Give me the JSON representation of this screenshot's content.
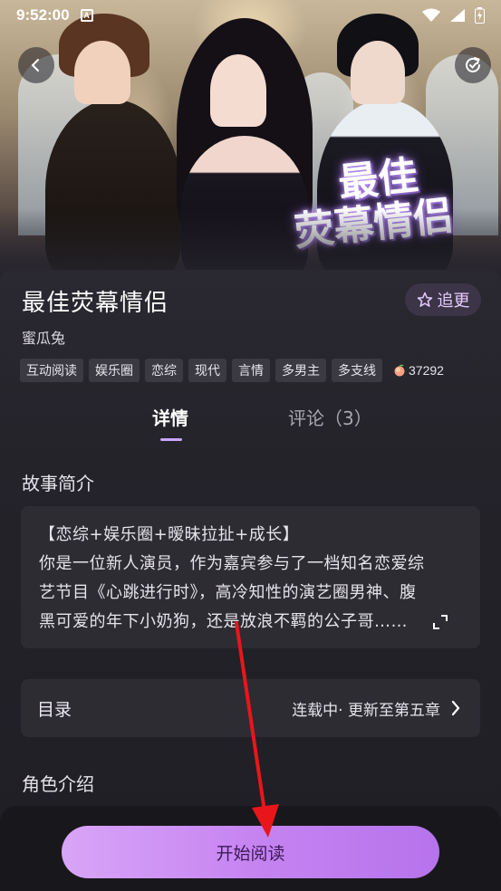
{
  "status_bar": {
    "time": "9:52:00",
    "notification_badge": "A"
  },
  "cover": {
    "title_line1": "最佳",
    "title_line2": "荧幕情侣"
  },
  "book": {
    "title": "最佳荧幕情侣",
    "follow_label": "追更",
    "author": "蜜瓜兔",
    "tags": [
      "互动阅读",
      "娱乐圈",
      "恋综",
      "现代",
      "言情",
      "多男主",
      "多支线"
    ],
    "heat": "37292"
  },
  "tabs": {
    "details": "详情",
    "comments": "评论（3）"
  },
  "synopsis": {
    "heading": "故事简介",
    "lines": [
      "【恋综+娱乐圈+暧昧拉扯+成长】",
      "你是一位新人演员，作为嘉宾参与了一档知名恋爱综",
      "艺节目《心跳进行时》，高冷知性的演艺圈男神、腹",
      "黑可爱的年下小奶狗，还是放浪不羁的公子哥……"
    ]
  },
  "catalog": {
    "label": "目录",
    "status": "连载中· 更新至第五章"
  },
  "characters": {
    "heading": "角色介绍"
  },
  "read_button": "开始阅读",
  "colors": {
    "accent": "#c684f1",
    "background": "#1d1c22",
    "annotation_arrow": "#e8161b"
  }
}
